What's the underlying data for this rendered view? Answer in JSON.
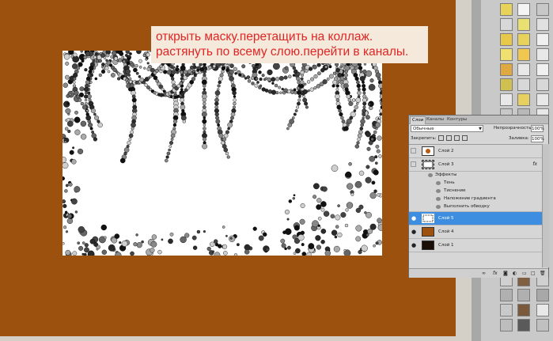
{
  "instruction": {
    "line1": "открыть маску.перетащить на коллаж.",
    "line2": "растянуть по всему слою.перейти в каналы."
  },
  "colors": {
    "canvas_fill": "#9c520e",
    "note_background": "#f4e9da",
    "note_text": "#e02525",
    "selected_layer": "#3d8ee0"
  },
  "layers_panel": {
    "tabs": [
      "Слои",
      "Каналы",
      "Контуры"
    ],
    "blend_mode": "Обычные",
    "opacity_label": "Непрозрачность:",
    "opacity_value": "100%",
    "lock_label": "Закрепить:",
    "fill_label": "Заливка:",
    "fill_value": "100%",
    "layers": [
      {
        "name": "Слой 2",
        "visible": false
      },
      {
        "name": "Слой 3",
        "visible": false,
        "fx": "fx"
      },
      {
        "name": "Слой 5",
        "visible": true,
        "selected": true
      },
      {
        "name": "Слой 4",
        "visible": true
      },
      {
        "name": "Слой 1",
        "visible": true
      }
    ],
    "effects_label": "Эффекты",
    "effects": [
      "Тень",
      "Тиснение",
      "Наложение градиента",
      "Выполнить обводку"
    ],
    "footer_icons": [
      "link-icon",
      "fx-icon",
      "mask-icon",
      "adjustment-icon",
      "folder-icon",
      "new-layer-icon",
      "trash-icon"
    ]
  }
}
